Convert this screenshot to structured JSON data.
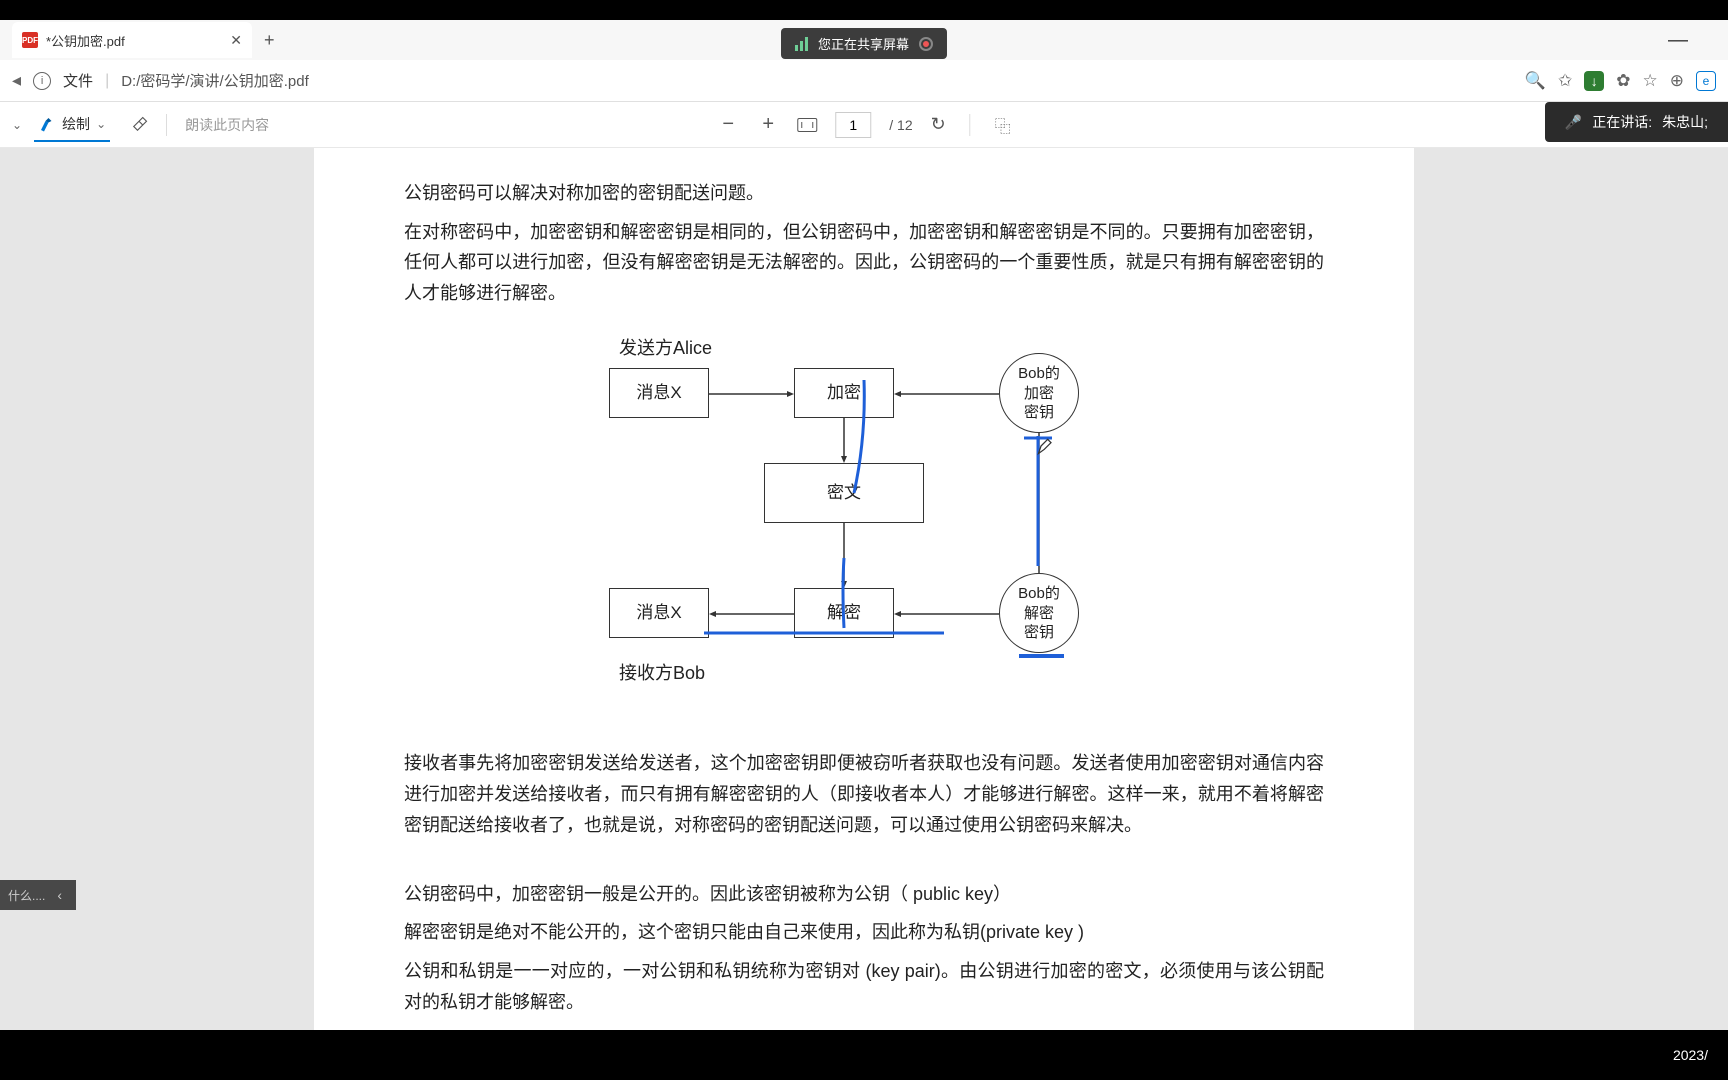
{
  "tab": {
    "title": "*公钥加密.pdf"
  },
  "share_banner": "您正在共享屏幕",
  "address": {
    "file_label": "文件",
    "path": "D:/密码学/演讲/公钥加密.pdf"
  },
  "toolbar": {
    "draw_label": "绘制",
    "read_aloud": "朗读此页内容",
    "page_current": "1",
    "page_total": "/ 12"
  },
  "speaking": {
    "prefix": "正在讲话:",
    "name": "朱忠山;"
  },
  "sidebar": {
    "label": "什么...."
  },
  "clock": "2023/",
  "doc": {
    "p1": "公钥密码可以解决对称加密的密钥配送问题。",
    "p2": "在对称密码中，加密密钥和解密密钥是相同的，但公钥密码中，加密密钥和解密密钥是不同的。只要拥有加密密钥，任何人都可以进行加密，但没有解密密钥是无法解密的。因此，公钥密码的一个重要性质，就是只有拥有解密密钥的人才能够进行解密。",
    "p3": "接收者事先将加密密钥发送给发送者，这个加密密钥即便被窃听者获取也没有问题。发送者使用加密密钥对通信内容进行加密并发送给接收者，而只有拥有解密密钥的人（即接收者本人）才能够进行解密。这样一来，就用不着将解密密钥配送给接收者了，也就是说，对称密码的密钥配送问题，可以通过使用公钥密码来解决。",
    "p4": "公钥密码中，加密密钥一般是公开的。因此该密钥被称为公钥（ public key）",
    "p5": "解密密钥是绝对不能公开的，这个密钥只能由自己来使用，因此称为私钥(private key )",
    "p6": "公钥和私钥是一一对应的，一对公钥和私钥统称为密钥对 (key pair)。由公钥进行加密的密文，必须使用与该公钥配对的私钥才能够解密。"
  },
  "diagram": {
    "sender": "发送方Alice",
    "receiver": "接收方Bob",
    "msg_x_1": "消息X",
    "msg_x_2": "消息X",
    "encrypt": "加密",
    "decrypt": "解密",
    "ciphertext": "密文",
    "bob_enc_1": "Bob的",
    "bob_enc_2": "加密",
    "bob_enc_3": "密钥",
    "bob_dec_1": "Bob的",
    "bob_dec_2": "解密",
    "bob_dec_3": "密钥"
  }
}
